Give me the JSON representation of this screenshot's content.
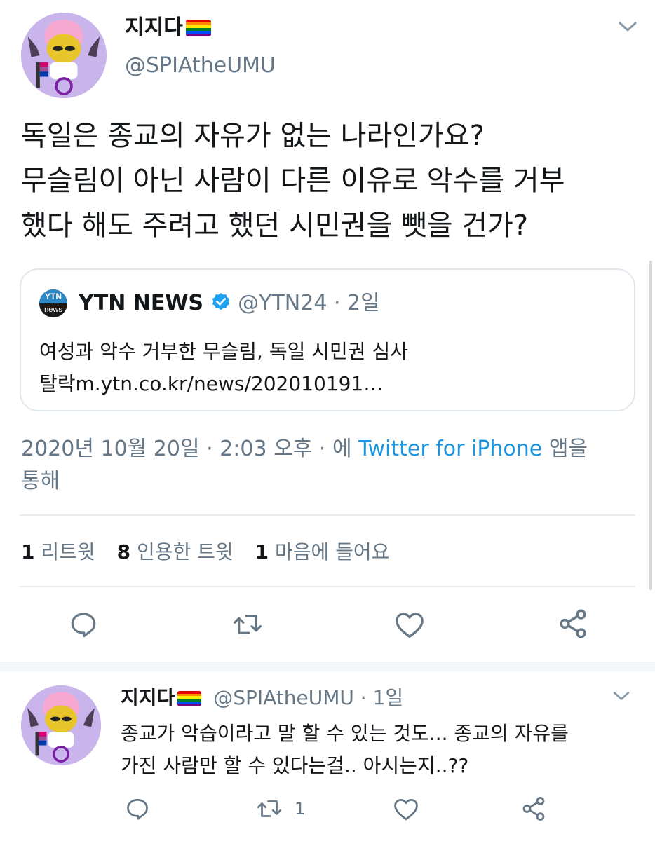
{
  "main_tweet": {
    "display_name": "지지다",
    "handle": "@SPIAtheUMU",
    "text_lines": [
      "독일은 종교의 자유가 없는 나라인가요?",
      "무슬림이 아닌 사람이 다른 이유로 악수를 거부",
      "했다 해도 주려고 했던 시민권을 뺏을 건가?"
    ],
    "quote": {
      "logo_text_top": "YTN",
      "logo_text_bottom": "news",
      "name": "YTN NEWS",
      "handle": "@YTN24",
      "separator": "·",
      "time": "2일",
      "text_line1": "여성과 악수 거부한 무슬림, 독일 시민권 심사",
      "text_line2": "탈락m.ytn.co.kr/news/202010191…"
    },
    "meta": {
      "date": "2020년 10월 20일",
      "separator1": "·",
      "time": "2:03 오후",
      "separator2": "·",
      "via_prefix": "에",
      "source": "Twitter for iPhone",
      "via_suffix": "앱을",
      "line2": "통해"
    },
    "stats": [
      {
        "count": "1",
        "label": "리트윗"
      },
      {
        "count": "8",
        "label": "인용한 트윗"
      },
      {
        "count": "1",
        "label": "마음에 들어요"
      }
    ]
  },
  "reply": {
    "display_name": "지지다",
    "handle": "@SPIAtheUMU",
    "separator": "·",
    "time": "1일",
    "text_line1": "종교가 악습이라고 말 할 수 있는 것도... 종교의 자유를",
    "text_line2": "가진 사람만 할 수 있다는걸.. 아시는지..??",
    "retweet_count": "1"
  },
  "colors": {
    "link": "#1b95e0",
    "secondary_text": "#657786",
    "divider": "#e6ecf0",
    "avatar_bg": "#c9b4ec",
    "verified": "#1da1f2"
  },
  "icons": [
    "chevron-down-icon",
    "reply-icon",
    "retweet-icon",
    "like-icon",
    "share-icon",
    "verified-badge-icon",
    "rainbow-flag-icon"
  ]
}
